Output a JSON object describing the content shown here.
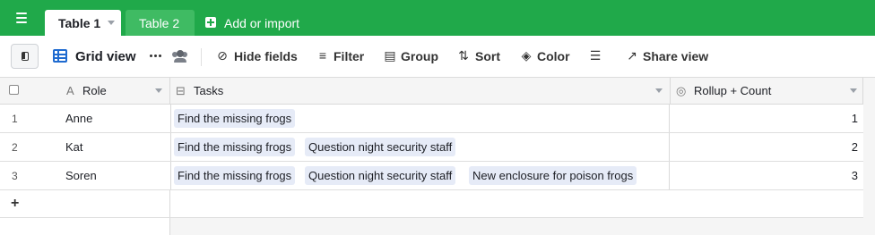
{
  "tabs": [
    {
      "label": "Table 1",
      "active": true
    },
    {
      "label": "Table 2",
      "active": false
    }
  ],
  "add_import_label": "Add or import",
  "toolbar": {
    "view_name": "Grid view",
    "items": [
      {
        "label": "Hide fields",
        "icon": "eye-slash-icon"
      },
      {
        "label": "Filter",
        "icon": "filter-icon"
      },
      {
        "label": "Group",
        "icon": "group-icon"
      },
      {
        "label": "Sort",
        "icon": "sort-icon"
      },
      {
        "label": "Color",
        "icon": "paint-bucket-icon"
      },
      {
        "label": "",
        "icon": "row-height-icon"
      },
      {
        "label": "Share view",
        "icon": "share-icon"
      }
    ]
  },
  "columns": [
    {
      "label": "Role",
      "icon": "text-field-icon"
    },
    {
      "label": "Tasks",
      "icon": "linked-record-icon"
    },
    {
      "label": "Rollup + Count",
      "icon": "rollup-icon"
    }
  ],
  "rows": [
    {
      "num": "1",
      "role": "Anne",
      "tasks": [
        "Find the missing frogs"
      ],
      "count": "1"
    },
    {
      "num": "2",
      "role": "Kat",
      "tasks": [
        "Find the missing frogs",
        "Question night security staff"
      ],
      "count": "2"
    },
    {
      "num": "3",
      "role": "Soren",
      "tasks": [
        "Find the missing frogs",
        "Question night security staff",
        "New enclosure for poison frogs"
      ],
      "count": "3"
    }
  ],
  "add_row_label": "+",
  "colors": {
    "topbar": "#20a94a",
    "tab_inactive": "#3fbb63",
    "view_icon": "#1f6bd0",
    "pill_bg": "#e6ebf7"
  }
}
